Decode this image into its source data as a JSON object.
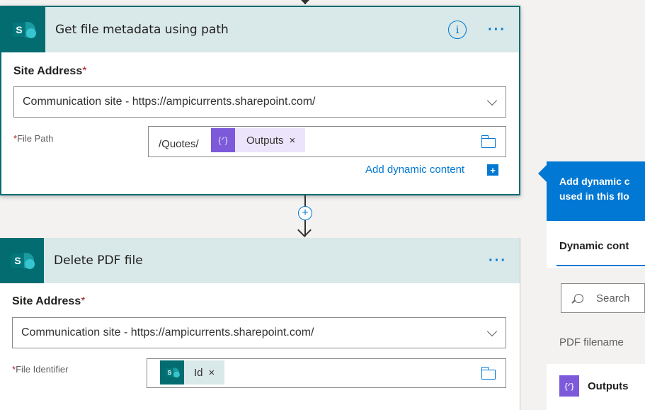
{
  "card1": {
    "title": "Get file metadata using path",
    "info_glyph": "i",
    "more_glyph": "···",
    "site_address_label": "Site Address",
    "required_mark": "*",
    "site_address_value": "Communication site - https://ampicurrents.sharepoint.com/",
    "file_path_label": "File Path",
    "file_path_prefix": "/Quotes/",
    "file_path_token": "Outputs",
    "token_remove_glyph": "×",
    "add_dynamic_content": "Add dynamic content"
  },
  "card2": {
    "title": "Delete PDF file",
    "more_glyph": "···",
    "site_address_label": "Site Address",
    "required_mark": "*",
    "site_address_value": "Communication site - https://ampicurrents.sharepoint.com/",
    "file_identifier_label": "File Identifier",
    "file_identifier_token": "Id",
    "token_remove_glyph": "×"
  },
  "panel": {
    "header_line1": "Add dynamic c",
    "header_line2": "used in this flo",
    "tab_label": "Dynamic cont",
    "search_placeholder": "Search",
    "group_label": "PDF filename",
    "item_label": "Outputs"
  },
  "icons": {
    "sharepoint": "sharepoint-logo-icon",
    "expression": "expression-icon",
    "folder": "folder-icon",
    "search": "search-icon",
    "plus": "plus-icon",
    "chevron": "chevron-down-icon"
  },
  "colors": {
    "accent": "#0078d4",
    "sharepoint": "#036c70",
    "header_bg": "#d9e8e8",
    "expression": "#7c5ad9",
    "required": "#a4262c"
  }
}
